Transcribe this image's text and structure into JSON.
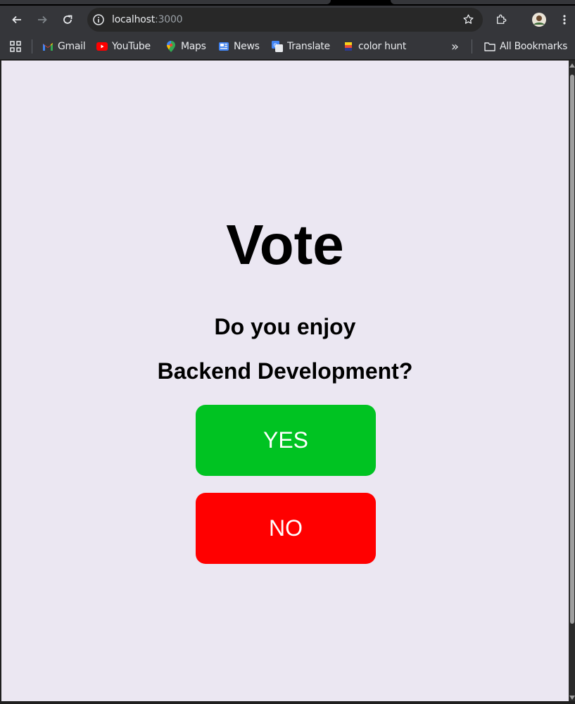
{
  "browser": {
    "url_host": "localhost",
    "url_port": ":3000",
    "bookmarks": [
      {
        "label": "Gmail"
      },
      {
        "label": "YouTube"
      },
      {
        "label": "Maps"
      },
      {
        "label": "News"
      },
      {
        "label": "Translate"
      },
      {
        "label": "color hunt"
      }
    ],
    "overflow_label": "»",
    "all_bookmarks_label": "All Bookmarks"
  },
  "page": {
    "title": "Vote",
    "question_line1": "Do you enjoy",
    "question_line2": "Backend Development?",
    "yes_label": "YES",
    "no_label": "NO"
  },
  "colors": {
    "page_background": "#ebe7f2",
    "yes_button": "#00c322",
    "no_button": "#ff0000"
  }
}
